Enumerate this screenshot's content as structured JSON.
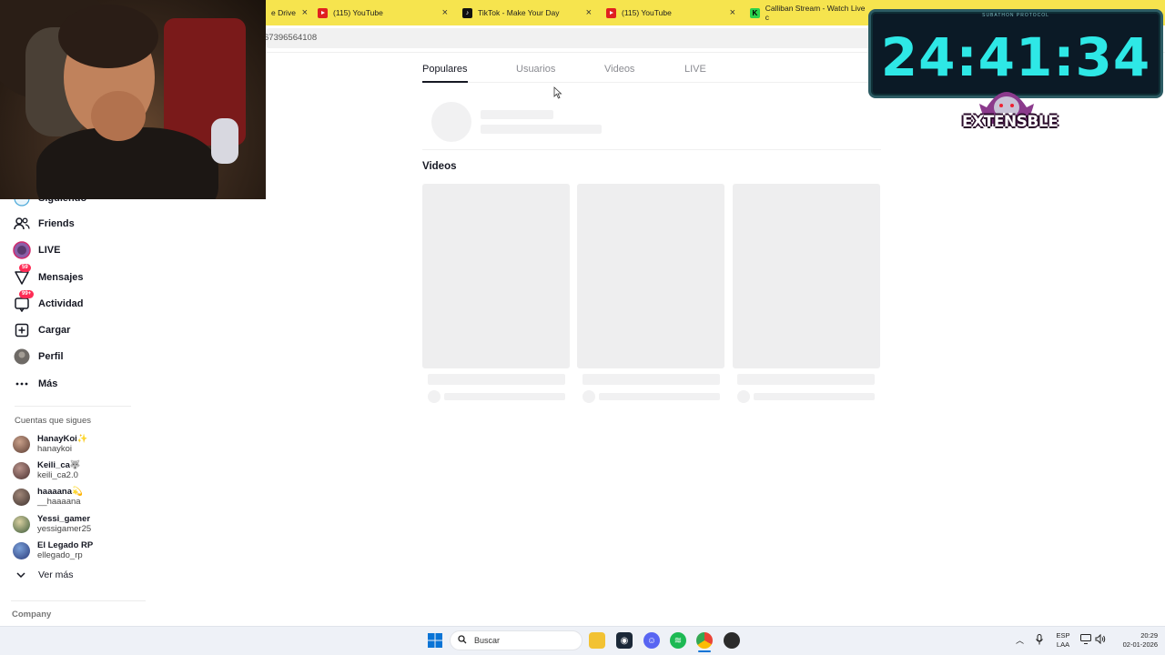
{
  "browser": {
    "tabs": [
      {
        "title": "e Drive",
        "icon": "drive-icon"
      },
      {
        "title": "(115) YouTube",
        "icon": "youtube-icon"
      },
      {
        "title": "TikTok - Make Your Day",
        "icon": "tiktok-icon"
      },
      {
        "title": "(115) YouTube",
        "icon": "youtube-icon"
      },
      {
        "title": "Calliban Stream - Watch Live c",
        "icon": "kick-icon"
      }
    ],
    "close_glyph": "×",
    "address": "67396564108"
  },
  "overlay": {
    "timer": "24:41:34",
    "timer_label": "SUBATHON PROTOCOL",
    "logo_text": "EXTENSBLE"
  },
  "sidebar": {
    "nav": [
      {
        "label": "Siguiendo",
        "icon": "following-icon"
      },
      {
        "label": "Friends",
        "icon": "friends-icon"
      },
      {
        "label": "LIVE",
        "icon": "live-icon"
      },
      {
        "label": "Mensajes",
        "icon": "messages-icon",
        "badge": "59"
      },
      {
        "label": "Actividad",
        "icon": "activity-icon",
        "badge": "99+"
      },
      {
        "label": "Cargar",
        "icon": "upload-icon"
      },
      {
        "label": "Perfil",
        "icon": "profile-icon"
      },
      {
        "label": "Más",
        "icon": "more-icon"
      }
    ],
    "following_title": "Cuentas que sigues",
    "accounts": [
      {
        "display": "HanayKoi✨",
        "user": "hanaykoi"
      },
      {
        "display": "Keili_ca🐺",
        "user": "keili_ca2.0"
      },
      {
        "display": "haaaana💫",
        "user": "__haaaana"
      },
      {
        "display": "Yessi_gamer",
        "user": "yessigamer25"
      },
      {
        "display": "El Legado RP",
        "user": "ellegado_rp"
      }
    ],
    "see_more": "Ver más",
    "company": "Company"
  },
  "main": {
    "tabs": [
      "Populares",
      "Usuarios",
      "Videos",
      "LIVE"
    ],
    "active_tab": "Populares",
    "videos_heading": "Videos"
  },
  "taskbar": {
    "search_placeholder": "Buscar",
    "lang": "ESP",
    "lang_sub": "LAA",
    "time": "20:29",
    "date": "02-01-2026"
  },
  "colors": {
    "accent": "#fe2c55",
    "tabbar": "#f6e44e",
    "timer": "#2ee8e6"
  }
}
